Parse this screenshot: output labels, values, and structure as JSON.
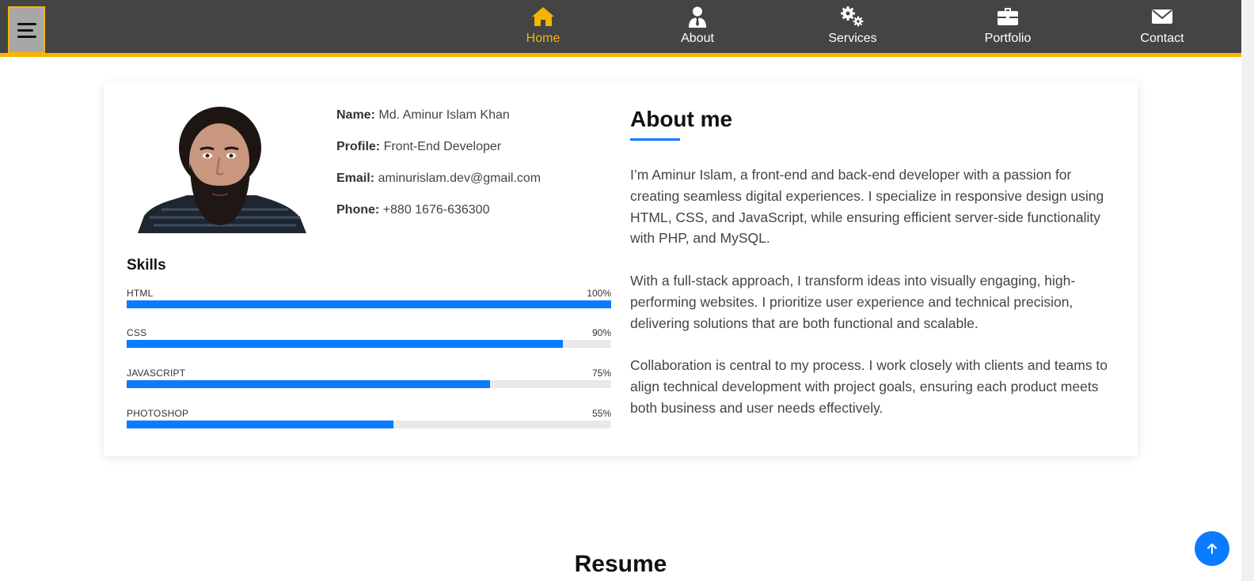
{
  "nav": {
    "items": [
      {
        "label": "Home",
        "icon": "home-icon",
        "active": true
      },
      {
        "label": "About",
        "icon": "user-tie-icon"
      },
      {
        "label": "Services",
        "icon": "gears-icon"
      },
      {
        "label": "Portfolio",
        "icon": "briefcase-icon"
      },
      {
        "label": "Contact",
        "icon": "envelope-icon"
      }
    ],
    "accent_color": "#f7b500",
    "background_color": "#444444"
  },
  "profile": {
    "photo_alt": "profile-photo",
    "fields": [
      {
        "label": "Name:",
        "value": "Md. Aminur Islam Khan"
      },
      {
        "label": "Profile:",
        "value": "Front-End Developer"
      },
      {
        "label": "Email:",
        "value": "aminurislam.dev@gmail.com"
      },
      {
        "label": "Phone:",
        "value": "+880 1676-636300"
      }
    ]
  },
  "skills": {
    "title": "Skills",
    "bar_color": "#0b7bff",
    "items": [
      {
        "name": "HTML",
        "percent_label": "100%",
        "percent": 100
      },
      {
        "name": "CSS",
        "percent_label": "90%",
        "percent": 90
      },
      {
        "name": "JAVASCRIPT",
        "percent_label": "75%",
        "percent": 75
      },
      {
        "name": "PHOTOSHOP",
        "percent_label": "55%",
        "percent": 55
      }
    ]
  },
  "about": {
    "title": "About me",
    "paragraphs": [
      "I’m Aminur Islam, a front-end and back-end developer with a passion for creating seamless digital experiences. I specialize in responsive design using HTML, CSS, and JavaScript, while ensuring efficient server-side functionality with PHP, and MySQL.",
      "With a full-stack approach, I transform ideas into visually engaging, high-performing websites. I prioritize user experience and technical precision, delivering solutions that are both functional and scalable.",
      "Collaboration is central to my process. I work closely with clients and teams to align technical development with project goals, ensuring each product meets both business and user needs effectively."
    ]
  },
  "resume": {
    "title": "Resume"
  },
  "scroll_top": {
    "icon": "arrow-up-icon"
  }
}
